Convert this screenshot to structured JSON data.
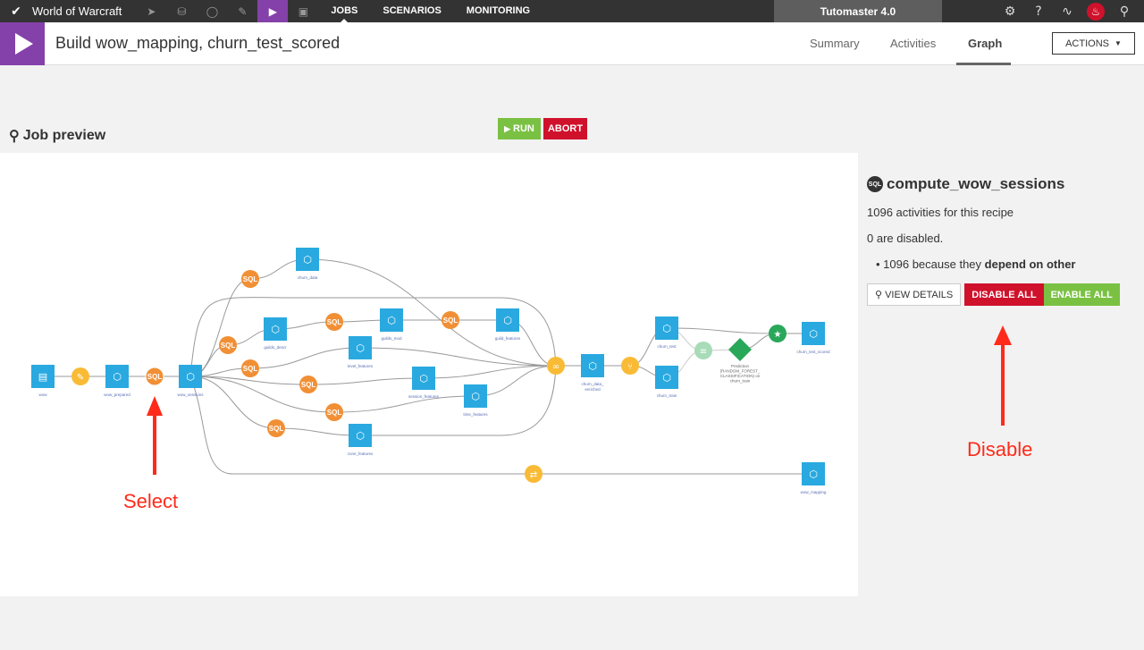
{
  "topbar": {
    "project": "World of Warcraft",
    "nav": [
      "JOBS",
      "SCENARIOS",
      "MONITORING"
    ],
    "instance": "Tutomaster 4.0"
  },
  "header": {
    "title": "Build wow_mapping, churn_test_scored",
    "tabs": [
      "Summary",
      "Activities",
      "Graph"
    ],
    "active_tab": "Graph",
    "actions": "ACTIONS"
  },
  "job": {
    "title": "Job preview",
    "run": "RUN",
    "abort": "ABORT"
  },
  "side": {
    "badge": "SQL",
    "recipe": "compute_wow_sessions",
    "activities": "1096 activities for this recipe",
    "disabled": "0 are disabled.",
    "bullet_count": "1096 because they ",
    "bullet_bold": "depend on other",
    "view_details": "VIEW DETAILS",
    "disable_all": "DISABLE ALL",
    "enable_all": "ENABLE ALL"
  },
  "annotations": {
    "select": "Select",
    "disable": "Disable"
  },
  "colors": {
    "dataset": "#29a9e0",
    "sql": "#f18f35",
    "visual": "#f9bb35",
    "ml": "#2aa85a",
    "ml_light": "#a8dbb7",
    "accent": "#8541aa",
    "danger": "#d0112b",
    "success": "#7ac143",
    "annotation": "#ff2a1a"
  },
  "graph": {
    "nodes": [
      {
        "id": "wow",
        "kind": "dataset",
        "label": "wow",
        "icon": "folder"
      },
      {
        "id": "prep",
        "kind": "visual",
        "label": "",
        "icon": "broom"
      },
      {
        "id": "wow_prepared",
        "kind": "dataset",
        "label": "wow_prepared"
      },
      {
        "id": "sql_sessions",
        "kind": "sql",
        "label": "SQL",
        "selected": true
      },
      {
        "id": "wow_sessions",
        "kind": "dataset",
        "label": "wow_sessions"
      },
      {
        "id": "sql_churn",
        "kind": "sql",
        "label": "SQL"
      },
      {
        "id": "churn_data",
        "kind": "dataset",
        "label": "churn_data"
      },
      {
        "id": "sql_gd",
        "kind": "sql",
        "label": "SQL"
      },
      {
        "id": "guilds_descr",
        "kind": "dataset",
        "label": "guilds_descr"
      },
      {
        "id": "sql_gm",
        "kind": "sql",
        "label": "SQL"
      },
      {
        "id": "guilds_mod",
        "kind": "dataset",
        "label": "guilds_mod"
      },
      {
        "id": "sql_gf",
        "kind": "sql",
        "label": "SQL"
      },
      {
        "id": "guild_features",
        "kind": "dataset",
        "label": "guild_features"
      },
      {
        "id": "sql_lf",
        "kind": "sql",
        "label": "SQL"
      },
      {
        "id": "level_features",
        "kind": "dataset",
        "label": "level_features"
      },
      {
        "id": "sql_sf",
        "kind": "sql",
        "label": "SQL"
      },
      {
        "id": "session_features",
        "kind": "dataset",
        "label": "session_features"
      },
      {
        "id": "sql_tf",
        "kind": "sql",
        "label": "SQL"
      },
      {
        "id": "time_features",
        "kind": "dataset",
        "label": "time_features"
      },
      {
        "id": "sql_zf",
        "kind": "sql",
        "label": "SQL"
      },
      {
        "id": "zone_features",
        "kind": "dataset",
        "label": "zone_features"
      },
      {
        "id": "join",
        "kind": "visual",
        "label": "",
        "icon": "join"
      },
      {
        "id": "churn_data_enriched",
        "kind": "dataset",
        "label": "churn_data_ enriched"
      },
      {
        "id": "split",
        "kind": "visual",
        "label": "",
        "icon": "split"
      },
      {
        "id": "churn_test",
        "kind": "dataset",
        "label": "churn_test"
      },
      {
        "id": "churn_train",
        "kind": "dataset",
        "label": "churn_train"
      },
      {
        "id": "train",
        "kind": "ml_light",
        "label": "",
        "icon": "dumbbell"
      },
      {
        "id": "model",
        "kind": "model",
        "label": "Prediction (RANDOM_FOREST_ CLASSIFICATION) on churn_train"
      },
      {
        "id": "score",
        "kind": "ml",
        "label": "",
        "icon": "trophy"
      },
      {
        "id": "churn_test_scored",
        "kind": "dataset",
        "label": "churn_test_scored"
      },
      {
        "id": "sync",
        "kind": "visual",
        "label": "",
        "icon": "sync"
      },
      {
        "id": "wow_mapping",
        "kind": "dataset",
        "label": "wow_mapping"
      }
    ],
    "edges": [
      [
        "wow",
        "prep"
      ],
      [
        "prep",
        "wow_prepared"
      ],
      [
        "wow_prepared",
        "sql_sessions"
      ],
      [
        "sql_sessions",
        "wow_sessions"
      ],
      [
        "wow_sessions",
        "sql_churn"
      ],
      [
        "sql_churn",
        "churn_data"
      ],
      [
        "wow_sessions",
        "sql_gd"
      ],
      [
        "sql_gd",
        "guilds_descr"
      ],
      [
        "guilds_descr",
        "sql_gm"
      ],
      [
        "sql_gm",
        "guilds_mod"
      ],
      [
        "guilds_mod",
        "sql_gf"
      ],
      [
        "sql_gf",
        "guild_features"
      ],
      [
        "wow_sessions",
        "sql_lf"
      ],
      [
        "sql_lf",
        "level_features"
      ],
      [
        "wow_sessions",
        "sql_sf"
      ],
      [
        "sql_sf",
        "session_features"
      ],
      [
        "wow_sessions",
        "sql_tf"
      ],
      [
        "sql_tf",
        "time_features"
      ],
      [
        "wow_sessions",
        "sql_zf"
      ],
      [
        "sql_zf",
        "zone_features"
      ],
      [
        "churn_data",
        "join"
      ],
      [
        "wow_sessions",
        "join"
      ],
      [
        "guild_features",
        "join"
      ],
      [
        "level_features",
        "join"
      ],
      [
        "session_features",
        "join"
      ],
      [
        "time_features",
        "join"
      ],
      [
        "zone_features",
        "join"
      ],
      [
        "join",
        "churn_data_enriched"
      ],
      [
        "churn_data_enriched",
        "split"
      ],
      [
        "split",
        "churn_test"
      ],
      [
        "split",
        "churn_train"
      ],
      [
        "churn_train",
        "train"
      ],
      [
        "churn_test",
        "train"
      ],
      [
        "train",
        "model"
      ],
      [
        "model",
        "score"
      ],
      [
        "churn_test",
        "score"
      ],
      [
        "score",
        "churn_test_scored"
      ],
      [
        "wow_sessions",
        "sync"
      ],
      [
        "sync",
        "wow_mapping"
      ]
    ]
  }
}
